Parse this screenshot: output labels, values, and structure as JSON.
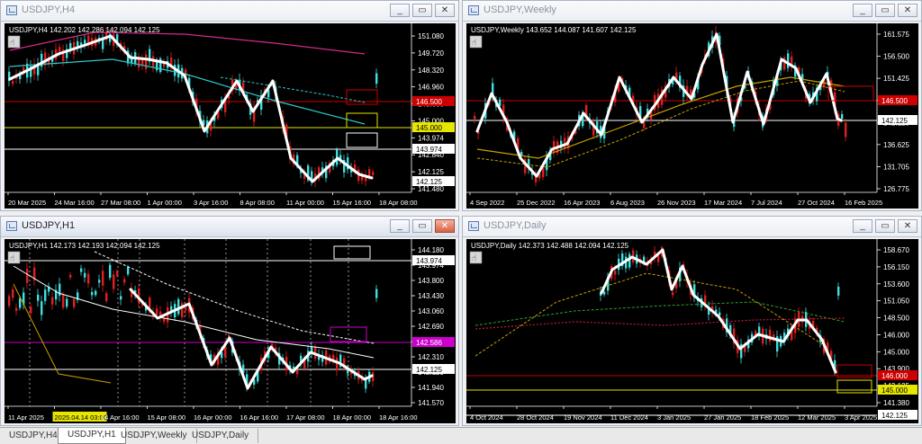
{
  "windows": [
    {
      "id": "h4",
      "title": "USDJPY,H4",
      "info": "USDJPY,H4  142.202 142.286 142.094 142.125",
      "active": false,
      "close_active": false,
      "prices": [
        "151.080",
        "149.720",
        "148.320",
        "146.960",
        "145.600",
        "145.000",
        "143.974",
        "142.840",
        "142.125",
        "141.480"
      ],
      "price_tags": [
        {
          "price": "146.500",
          "color": "#cc0000"
        },
        {
          "price": "145.000",
          "color": "#e6e600"
        },
        {
          "price": "143.974",
          "color": "#ffffff"
        },
        {
          "price": "142.125",
          "color": "#ffffff"
        }
      ],
      "dates": [
        "20 Mar 2025",
        "24 Mar 16:00",
        "27 Mar 08:00",
        "1 Apr 00:00",
        "3 Apr 16:00",
        "8 Apr 08:00",
        "11 Apr 00:00",
        "15 Apr 16:00",
        "18 Apr 08:00"
      ]
    },
    {
      "id": "weekly",
      "title": "USDJPY,Weekly",
      "info": "USDJPY,Weekly  143.652 144.087 141.607 142.125",
      "active": false,
      "close_active": false,
      "prices": [
        "161.575",
        "156.500",
        "151.425",
        "146.500",
        "142.125",
        "136.625",
        "131.705",
        "126.775"
      ],
      "price_tags": [
        {
          "price": "146.500",
          "color": "#cc0000"
        },
        {
          "price": "142.125",
          "color": "#ffffff"
        }
      ],
      "dates": [
        "4 Sep 2022",
        "25 Dec 2022",
        "16 Apr 2023",
        "6 Aug 2023",
        "26 Nov 2023",
        "17 Mar 2024",
        "7 Jul 2024",
        "27 Oct 2024",
        "16 Feb 2025"
      ]
    },
    {
      "id": "h1",
      "title": "USDJPY,H1",
      "info": "USDJPY,H1  142.173 142.193 142.094 142.125",
      "active": true,
      "close_active": true,
      "prices": [
        "144.180",
        "143.974",
        "143.800",
        "143.430",
        "143.060",
        "142.690",
        "142.586",
        "142.310",
        "142.125",
        "141.940",
        "141.570"
      ],
      "price_tags": [
        {
          "price": "143.974",
          "color": "#ffffff"
        },
        {
          "price": "142.586",
          "color": "#cc00cc"
        },
        {
          "price": "142.125",
          "color": "#ffffff"
        }
      ],
      "dates": [
        "11 Apr 2025",
        "2025.04.14 03:00",
        "14 Apr 16:00",
        "15 Apr 08:00",
        "16 Apr 00:00",
        "16 Apr 16:00",
        "17 Apr 08:00",
        "18 Apr 00:00",
        "18 Apr 16:00"
      ]
    },
    {
      "id": "daily",
      "title": "USDJPY,Daily",
      "info": "USDJPY,Daily  142.373 142.488 142.094 142.125",
      "active": false,
      "close_active": false,
      "prices": [
        "158.670",
        "156.150",
        "153.600",
        "151.050",
        "148.500",
        "146.000",
        "145.000",
        "143.900",
        "142.125",
        "141.380"
      ],
      "price_tags": [
        {
          "price": "146.000",
          "color": "#cc0000"
        },
        {
          "price": "145.000",
          "color": "#e6e600"
        },
        {
          "price": "142.125",
          "color": "#ffffff"
        }
      ],
      "dates": [
        "4 Oct 2024",
        "28 Oct 2024",
        "19 Nov 2024",
        "11 Dec 2024",
        "3 Jan 2025",
        "27 Jan 2025",
        "18 Feb 2025",
        "12 Mar 2025",
        "3 Apr 2025"
      ]
    }
  ],
  "tabs": [
    "USDJPY,H4",
    "USDJPY,H1",
    "USDJPY,Weekly",
    "USDJPY,Daily"
  ],
  "active_tab": "USDJPY,H1",
  "colors": {
    "bull": "#40e0e0",
    "bear": "#e02020",
    "background": "#000000",
    "text": "#ffffff"
  }
}
